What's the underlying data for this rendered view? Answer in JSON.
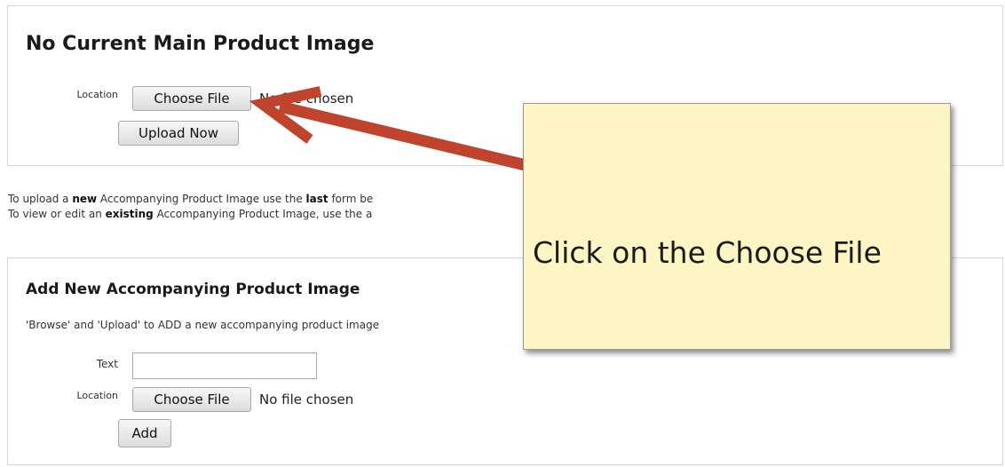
{
  "main_panel": {
    "title": "No Current Main Product Image",
    "location_label": "Location",
    "choose_file_label": "Choose File",
    "no_file_text": "No file chosen",
    "upload_label": "Upload Now"
  },
  "info": {
    "line1_a": "To upload a ",
    "line1_b": "new",
    "line1_c": " Accompanying Product Image use the ",
    "line1_d": "last",
    "line1_e": " form be",
    "line2_a": "To view or edit an ",
    "line2_b": "existing",
    "line2_c": " Accompanying Product Image, use the a"
  },
  "add_panel": {
    "title": "Add New Accompanying Product Image",
    "description": "'Browse' and 'Upload' to ADD a new accompanying product image",
    "text_label": "Text",
    "text_value": "",
    "location_label": "Location",
    "choose_file_label": "Choose File",
    "no_file_text": "No file chosen",
    "add_label": "Add"
  },
  "callout": {
    "text": "Click on the Choose File",
    "background": "#fdf5c4"
  },
  "arrow": {
    "color": "#c0432d"
  }
}
